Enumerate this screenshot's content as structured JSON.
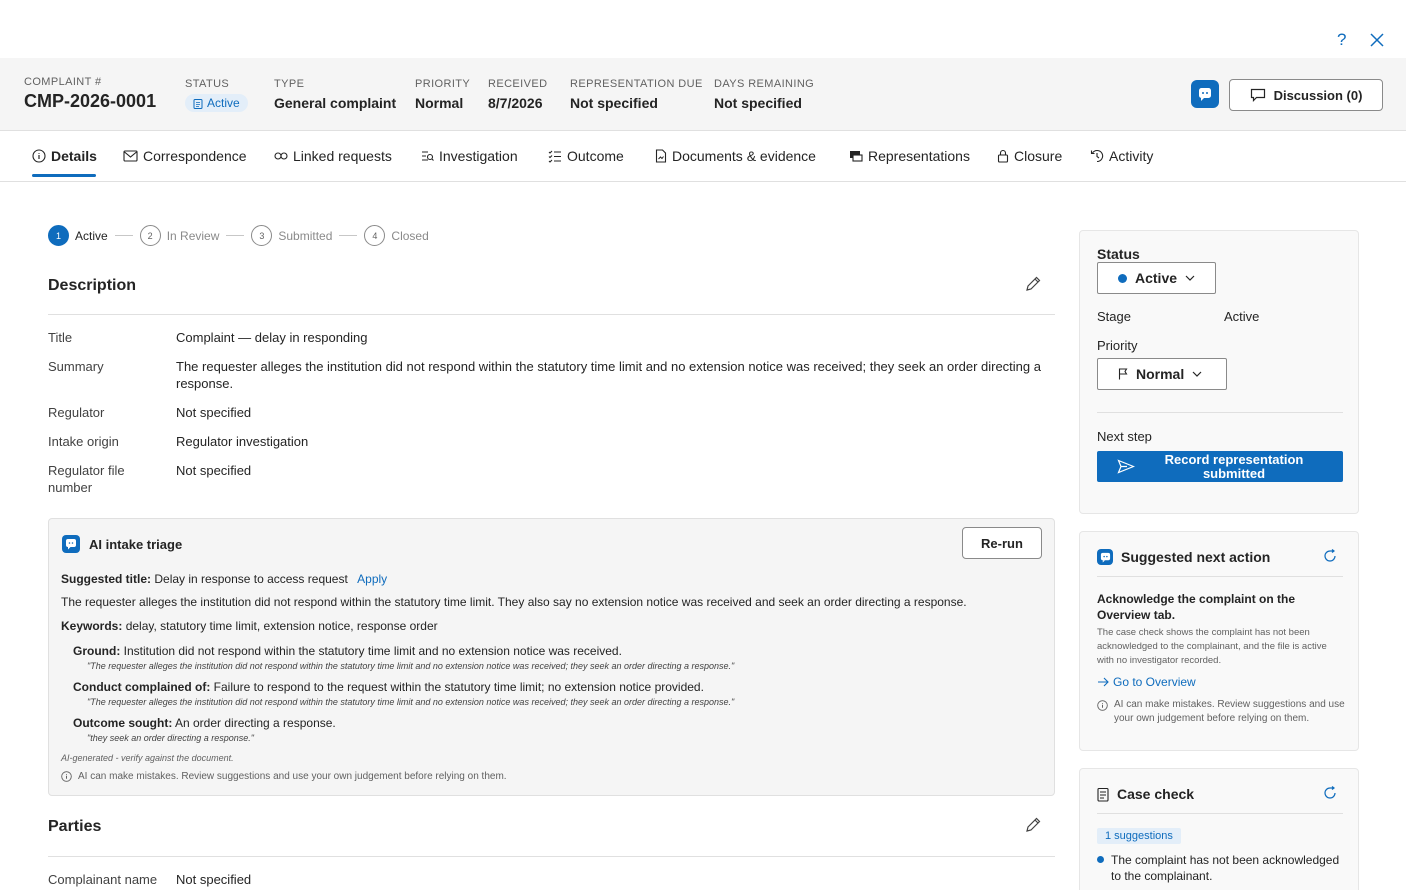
{
  "topbar": {
    "help": "?",
    "close": "×"
  },
  "header": {
    "complaint_label": "COMPLAINT #",
    "complaint_id": "CMP-2026-0001",
    "status_label": "STATUS",
    "status_value": "Active",
    "type_label": "TYPE",
    "type_value": "General complaint",
    "priority_label": "PRIORITY",
    "priority_value": "Normal",
    "received_label": "RECEIVED",
    "received_value": "8/7/2026",
    "rep_due_label": "REPRESENTATION DUE",
    "rep_due_value": "Not specified",
    "days_label": "DAYS REMAINING",
    "days_value": "Not specified",
    "discussion_label": "Discussion (0)"
  },
  "tabs": [
    {
      "label": "Details",
      "icon": "info-icon"
    },
    {
      "label": "Correspondence",
      "icon": "mail-icon"
    },
    {
      "label": "Linked requests",
      "icon": "link-icon"
    },
    {
      "label": "Investigation",
      "icon": "investigation-icon"
    },
    {
      "label": "Outcome",
      "icon": "list-check-icon"
    },
    {
      "label": "Documents & evidence",
      "icon": "document-icon"
    },
    {
      "label": "Representations",
      "icon": "representations-icon"
    },
    {
      "label": "Closure",
      "icon": "lock-icon"
    },
    {
      "label": "Activity",
      "icon": "history-icon"
    }
  ],
  "stepper": [
    {
      "num": "1",
      "label": "Active"
    },
    {
      "num": "2",
      "label": "In Review"
    },
    {
      "num": "3",
      "label": "Submitted"
    },
    {
      "num": "4",
      "label": "Closed"
    }
  ],
  "description": {
    "title": "Description",
    "rows": [
      {
        "label": "Title",
        "value": "Complaint — delay in responding"
      },
      {
        "label": "Summary",
        "value": "The requester alleges the institution did not respond within the statutory time limit and no extension notice was received; they seek an order directing a response."
      },
      {
        "label": "Regulator",
        "value": "Not specified"
      },
      {
        "label": "Intake origin",
        "value": "Regulator investigation"
      },
      {
        "label": "Regulator file number",
        "value": "Not specified"
      }
    ]
  },
  "ai_triage": {
    "title": "AI intake triage",
    "rerun": "Re-run",
    "suggested_title_label": "Suggested title:",
    "suggested_title": "Delay in response to access request",
    "apply": "Apply",
    "summary": "The requester alleges the institution did not respond within the statutory time limit. They also say no extension notice was received and seek an order directing a response.",
    "keywords_label": "Keywords:",
    "keywords": "delay, statutory time limit, extension notice, response order",
    "ground_label": "Ground:",
    "ground": "Institution did not respond within the statutory time limit and no extension notice was received.",
    "ground_quote": "\"The requester alleges the institution did not respond within the statutory time limit and no extension notice was received; they seek an order directing a response.\"",
    "conduct_label": "Conduct complained of:",
    "conduct": "Failure to respond to the request within the statutory time limit; no extension notice provided.",
    "conduct_quote": "\"The requester alleges the institution did not respond within the statutory time limit and no extension notice was received; they seek an order directing a response.\"",
    "outcome_label": "Outcome sought:",
    "outcome": "An order directing a response.",
    "outcome_quote": "\"they seek an order directing a response.\"",
    "generated_note": "AI-generated - verify against the document.",
    "disclaimer": "AI can make mistakes. Review suggestions and use your own judgement before relying on them."
  },
  "parties": {
    "title": "Parties",
    "rows": [
      {
        "label": "Complainant name",
        "value": "Not specified"
      }
    ]
  },
  "status_panel": {
    "status_label": "Status",
    "status_value": "Active",
    "stage_label": "Stage",
    "stage_value": "Active",
    "priority_label": "Priority",
    "priority_value": "Normal",
    "next_step_label": "Next step",
    "next_step_button": "Record representation submitted"
  },
  "suggested_action": {
    "title": "Suggested next action",
    "heading": "Acknowledge the complaint on the Overview tab.",
    "body": "The case check shows the complaint has not been acknowledged to the complainant, and the file is active with no investigator recorded.",
    "link": "Go to Overview",
    "disclaimer": "AI can make mistakes. Review suggestions and use your own judgement before relying on them."
  },
  "case_check": {
    "title": "Case check",
    "badge": "1 suggestions",
    "item": "The complaint has not been acknowledged to the complainant."
  },
  "colors": {
    "accent": "#0f6cbd",
    "header_bg": "#f5f5f5"
  }
}
